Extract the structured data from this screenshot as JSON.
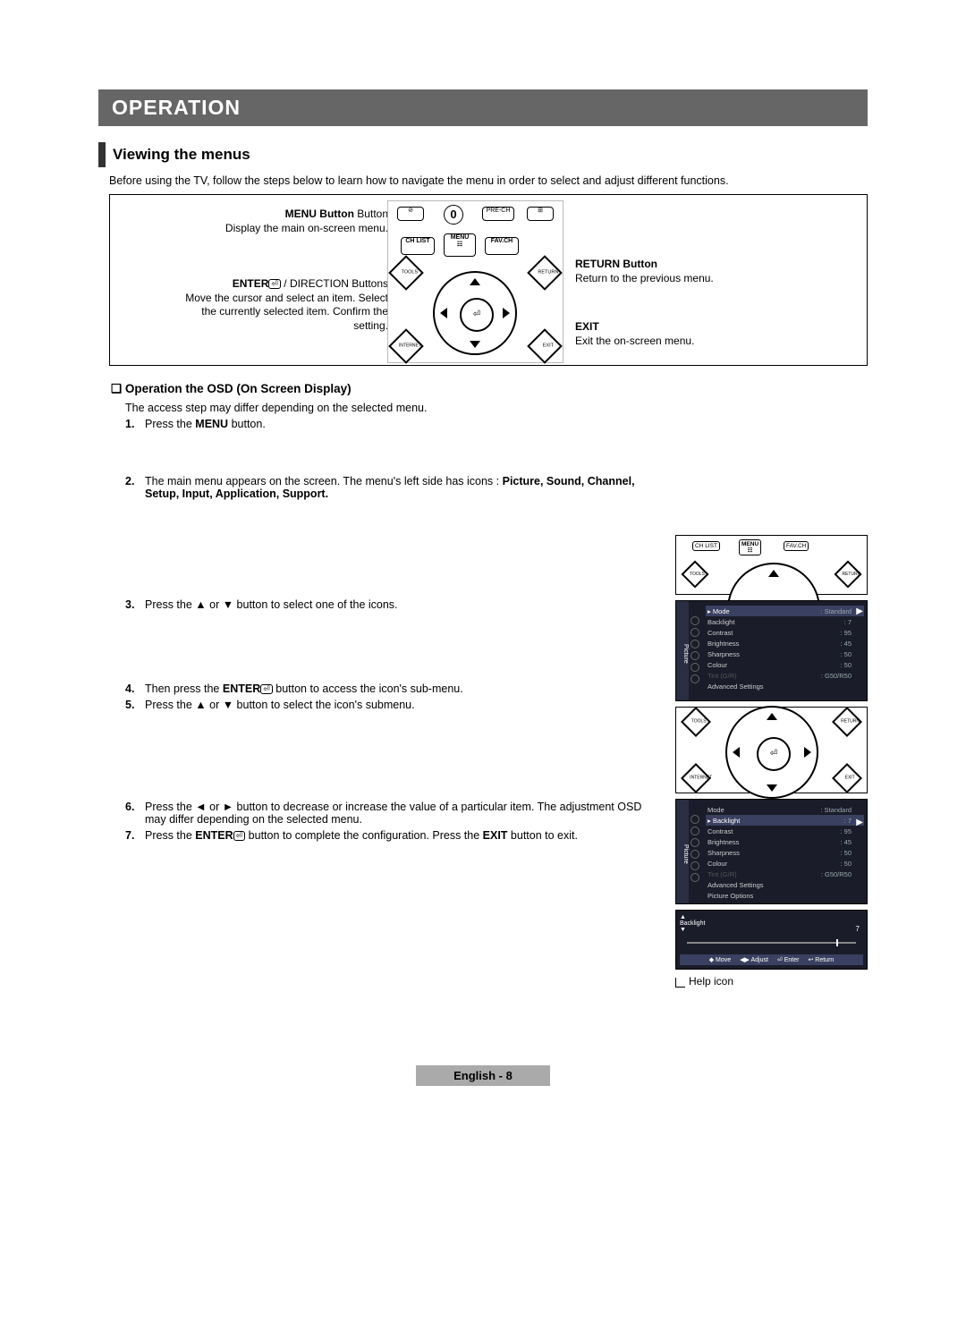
{
  "banner": "OPERATION",
  "section_title": "Viewing the menus",
  "intro": "Before using the TV, follow the steps below to learn how to navigate the menu in order to select and adjust different functions.",
  "callouts": {
    "menu_title": "MENU Button",
    "menu_desc": "Display the main on-screen menu.",
    "enter_title_a": "ENTER",
    "enter_title_b": " / DIRECTION Buttons",
    "enter_desc": "Move the cursor and select an item. Select the currently selected item. Confirm the setting.",
    "return_title": "RETURN Button",
    "return_desc": "Return to the previous menu.",
    "exit_title": "EXIT",
    "exit_desc": "Exit the on-screen menu."
  },
  "remote_labels": {
    "prech": "PRE-CH",
    "chlist": "CH LIST",
    "menu": "MENU",
    "favch": "FAV.CH",
    "tools": "TOOLS",
    "return": "RETURN",
    "internet": "INTERNET",
    "exit": "EXIT",
    "enter_glyph": "⏎"
  },
  "sub_heading": "Operation the OSD (On Screen Display)",
  "sub_intro": "The access step may differ depending on the selected menu.",
  "steps": {
    "s1a": "Press the ",
    "s1b": "MENU",
    "s1c": " button.",
    "s2a": "The main menu appears on the screen. The menu's left side has icons : ",
    "s2b": "Picture, Sound, Channel, Setup, Input, Application, Support.",
    "s3": "Press the ▲ or ▼ button to select one of the icons.",
    "s4a": "Then press the ",
    "s4b": "ENTER",
    "s4c": " button to access the icon's sub-menu.",
    "s5": "Press the ▲ or ▼ button to select the icon's submenu.",
    "s6": "Press the ◄ or ► button to decrease or increase the value of a particular item. The adjustment OSD may differ depending on the selected menu.",
    "s7a": "Press the ",
    "s7b": "ENTER",
    "s7c": " button to complete the configuration. Press the ",
    "s7d": "EXIT",
    "s7e": " button to exit."
  },
  "osd1": {
    "tab": "Picture",
    "rows": [
      {
        "k": "Mode",
        "v": ": Standard",
        "hl": true
      },
      {
        "k": "Backlight",
        "v": ": 7"
      },
      {
        "k": "Contrast",
        "v": ": 95"
      },
      {
        "k": "Brightness",
        "v": ": 45"
      },
      {
        "k": "Sharpness",
        "v": ": 50"
      },
      {
        "k": "Colour",
        "v": ": 50"
      },
      {
        "k": "Tint (G/R)",
        "v": ": G50/R50",
        "dim": true
      },
      {
        "k": "Advanced Settings",
        "v": ""
      }
    ]
  },
  "osd2": {
    "tab": "Picture",
    "rows": [
      {
        "k": "Mode",
        "v": ": Standard"
      },
      {
        "k": "Backlight",
        "v": ": 7",
        "hl": true
      },
      {
        "k": "Contrast",
        "v": ": 95"
      },
      {
        "k": "Brightness",
        "v": ": 45"
      },
      {
        "k": "Sharpness",
        "v": ": 50"
      },
      {
        "k": "Colour",
        "v": ": 50"
      },
      {
        "k": "Tint (G/R)",
        "v": ": G50/R50",
        "dim": true
      },
      {
        "k": "Advanced Settings",
        "v": ""
      },
      {
        "k": "Picture Options",
        "v": ""
      }
    ]
  },
  "slider": {
    "label": "Backlight",
    "value": "7",
    "help": [
      "◆ Move",
      "◀▶ Adjust",
      "⏎ Enter",
      "↩ Return"
    ]
  },
  "help_caption": "Help icon",
  "footer": "English - 8"
}
